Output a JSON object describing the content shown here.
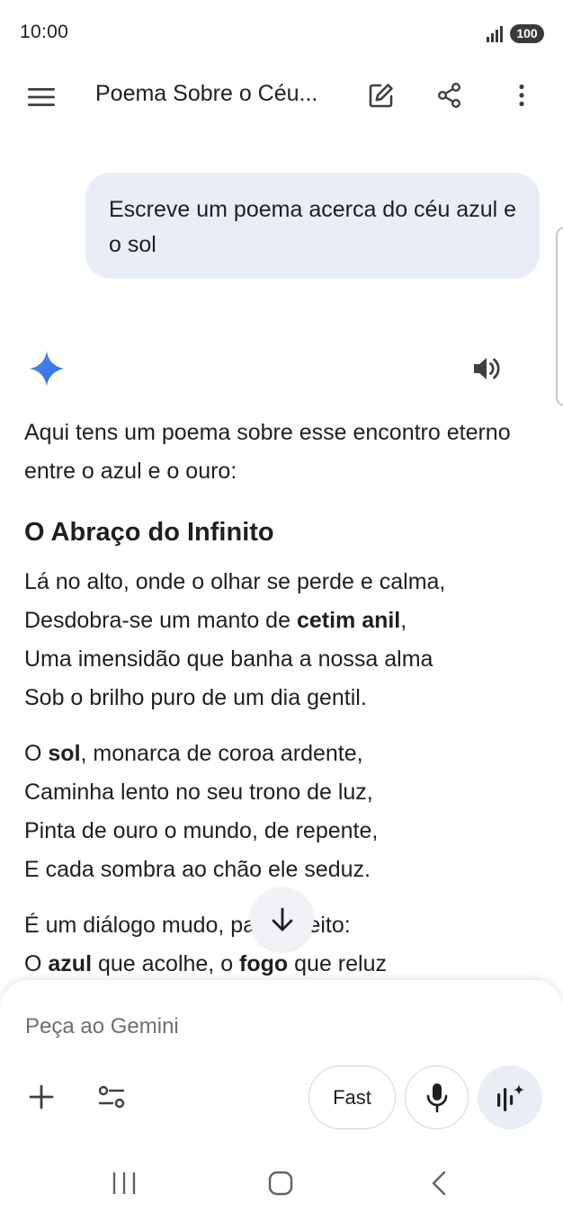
{
  "status_bar": {
    "time": "10:00",
    "battery": "100",
    "icons": [
      "signal-icon"
    ]
  },
  "app_bar": {
    "title": "Poema Sobre o Céu...",
    "icons": [
      "menu-icon",
      "edit-icon",
      "share-icon",
      "more-vert-icon"
    ]
  },
  "chat": {
    "user_message": "Escreve um poema acerca do céu azul e o sol",
    "response": {
      "icons": [
        "gemini-sparkle-icon",
        "speaker-icon"
      ],
      "intro": "Aqui tens um poema sobre esse encontro eterno entre o azul e o ouro:",
      "poem_title": "O Abraço do Infinito",
      "stanza1": {
        "line1": "Lá no alto, onde o olhar se perde e calma,",
        "line2_pre": "Desdobra-se um manto de ",
        "line2_bold": "cetim anil",
        "line2_post": ",",
        "line3": "Uma imensidão que banha a nossa alma",
        "line4": "Sob o brilho puro de um dia gentil."
      },
      "stanza2": {
        "line1_pre": "O ",
        "line1_bold": "sol",
        "line1_post": ", monarca de coroa ardente,",
        "line2": "Caminha lento no seu trono de luz,",
        "line3": "Pinta de ouro o mundo, de repente,",
        "line4": "E cada sombra ao chão ele seduz."
      },
      "stanza3": {
        "line1": "É um diálogo mudo, par perfeito:",
        "line2_pre": "O ",
        "line2_bold1": "azul",
        "line2_mid": " que acolhe, o ",
        "line2_bold2": "fogo",
        "line2_post": " que reluz"
      }
    }
  },
  "scroll_down": {
    "icon": "arrow-down-icon"
  },
  "composer": {
    "placeholder": "Peça ao Gemini",
    "value": "",
    "mode_label": "Fast",
    "icons": [
      "plus-icon",
      "tools-icon",
      "mic-icon",
      "live-icon"
    ]
  },
  "nav_bar": {
    "icons": [
      "recents-icon",
      "home-icon",
      "back-icon"
    ]
  }
}
